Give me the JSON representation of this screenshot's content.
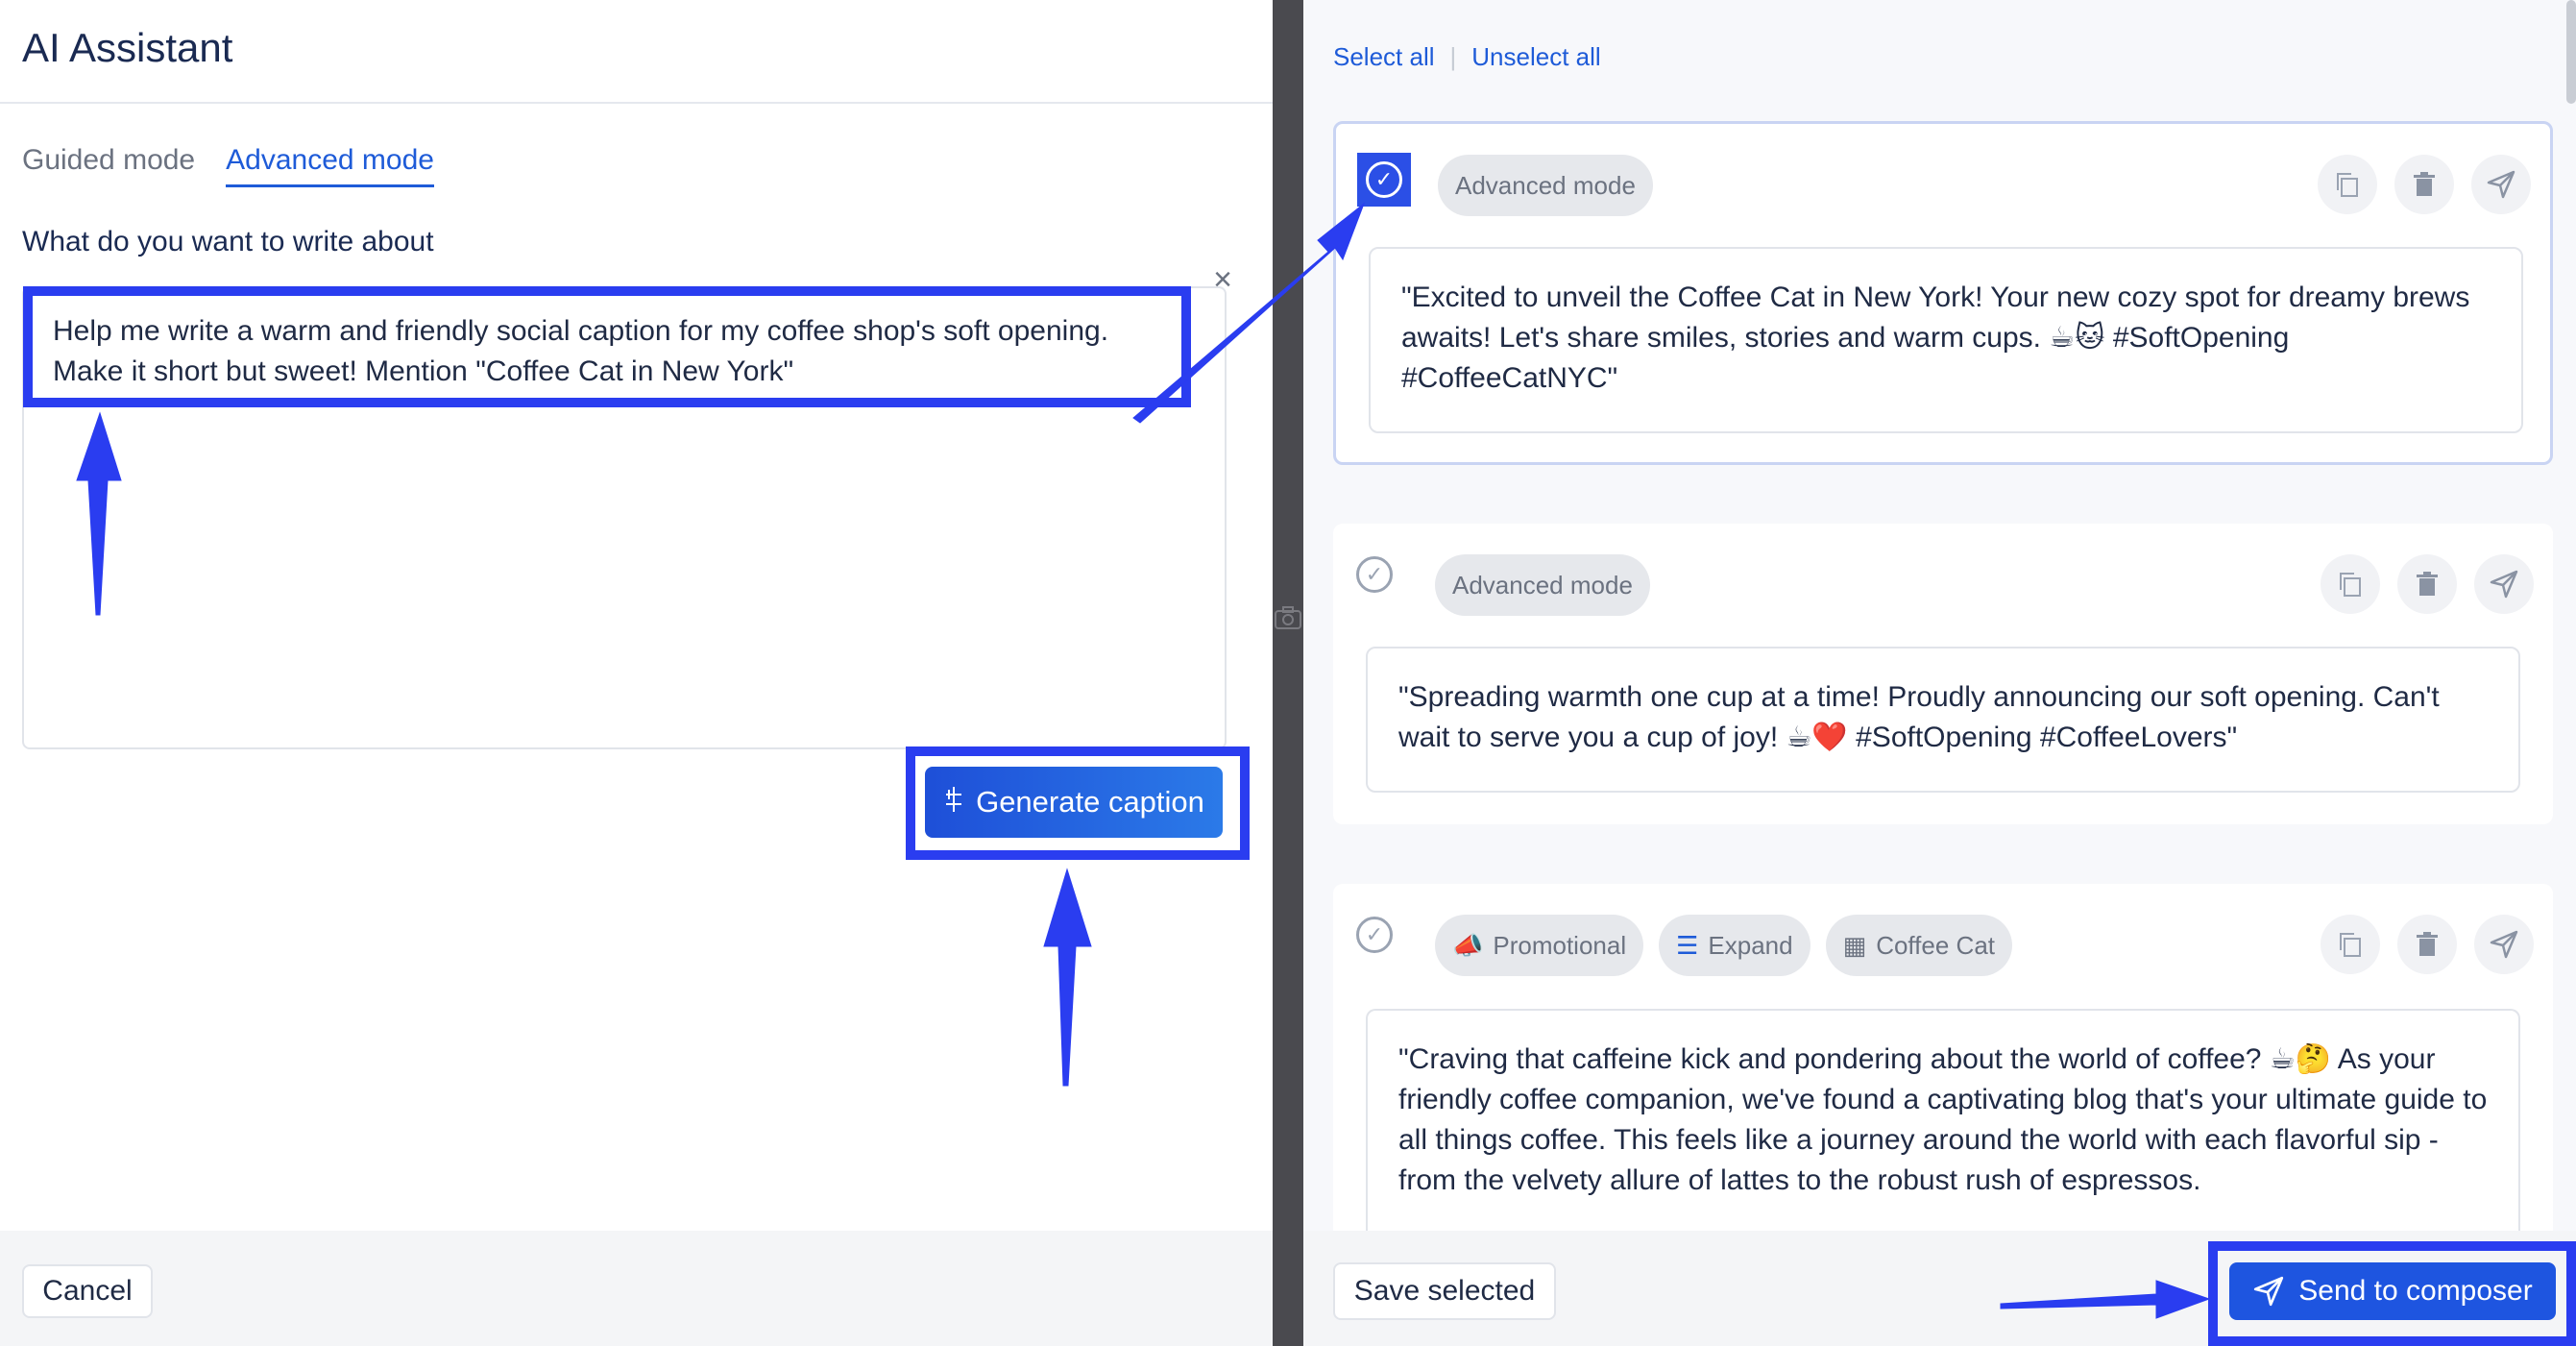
{
  "left": {
    "title": "AI Assistant",
    "tabs": [
      {
        "label": "Guided mode",
        "active": false
      },
      {
        "label": "Advanced mode",
        "active": true
      }
    ],
    "prompt_label": "What do you want to write about",
    "prompt_value": "Help me write a warm and friendly social caption for my coffee shop's soft opening.\nMake it short but sweet! Mention \"Coffee Cat in New York\"",
    "generate_label": "Generate caption",
    "cancel_label": "Cancel"
  },
  "right": {
    "select_all": "Select all",
    "unselect_all": "Unselect all",
    "cards": [
      {
        "selected": true,
        "chips": [
          {
            "label": "Advanced mode"
          }
        ],
        "caption": "\"Excited to unveil the Coffee Cat in New York! Your new cozy spot for dreamy brews awaits! Let's share smiles, stories and warm cups. ☕🐱 #SoftOpening #CoffeeCatNYC\""
      },
      {
        "selected": false,
        "chips": [
          {
            "label": "Advanced mode"
          }
        ],
        "caption": "\"Spreading warmth one cup at a time! Proudly announcing our soft opening. Can't wait to serve you a cup of joy! ☕❤️ #SoftOpening #CoffeeLovers\""
      },
      {
        "selected": false,
        "chips": [
          {
            "label": "Promotional",
            "icon": "megaphone-icon",
            "glyph": "📣"
          },
          {
            "label": "Expand",
            "icon": "lines-icon",
            "glyph": "☰"
          },
          {
            "label": "Coffee Cat",
            "icon": "building-icon",
            "glyph": "▦"
          }
        ],
        "caption": "\"Craving that caffeine kick and pondering about the world of coffee? ☕🤔 As your friendly coffee companion, we've found a captivating blog that's your ultimate guide to all things coffee. This feels like a journey around the world with each flavorful sip - from the velvety allure of lattes to the robust rush of espressos."
      }
    ],
    "save_label": "Save selected",
    "send_label": "Send to composer"
  },
  "colors": {
    "accent": "#1e5bd8",
    "highlight": "#2a3df0",
    "divider": "#4a4a4f"
  }
}
